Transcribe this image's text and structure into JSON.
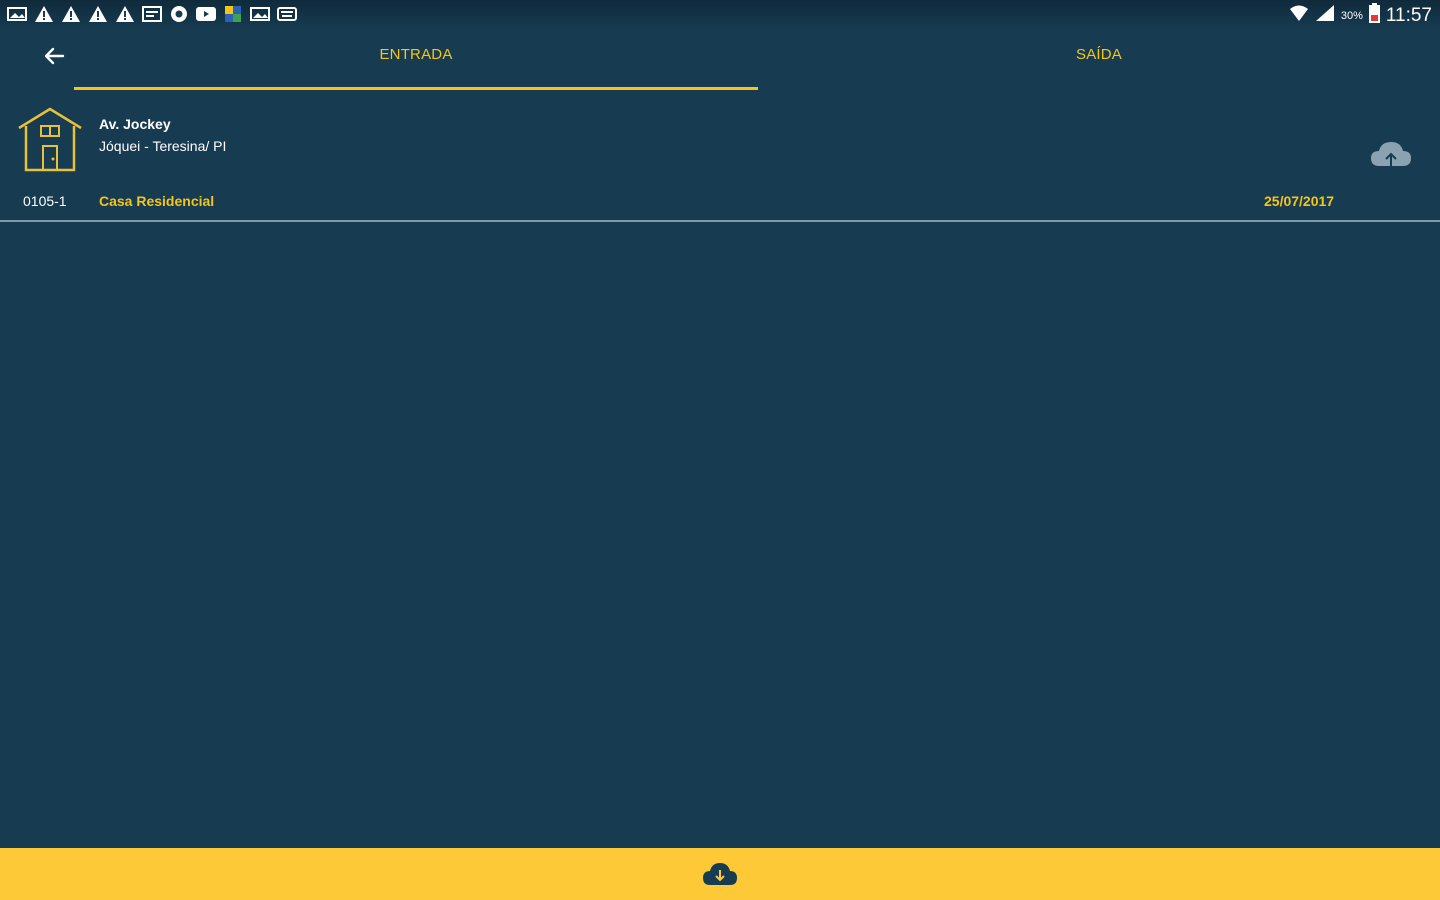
{
  "status_bar": {
    "time": "11:57",
    "battery_percent": "30%",
    "notification_icons": [
      "gallery-icon",
      "warning-icon",
      "warning-icon",
      "warning-icon",
      "warning-icon",
      "calendar-icon",
      "chrome-icon",
      "youtube-icon",
      "app-icon",
      "gallery-icon",
      "keyboard-icon"
    ]
  },
  "tabs": [
    {
      "label": "ENTRADA",
      "selected": true
    },
    {
      "label": "SAÍDA",
      "selected": false
    }
  ],
  "item": {
    "address_line1": "Av. Jockey",
    "address_line2": "Jóquei - Teresina/ PI",
    "code": "0105-1",
    "type": "Casa Residencial",
    "date": "25/07/2017"
  },
  "colors": {
    "background": "#173b51",
    "accent": "#f5c518",
    "bottom_bar": "#fdc936"
  }
}
